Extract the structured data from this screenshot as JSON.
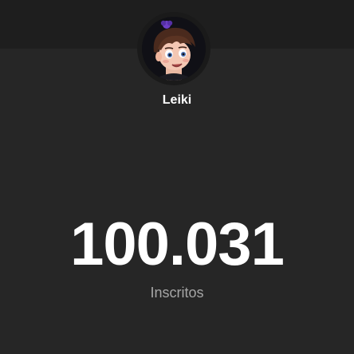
{
  "channel": {
    "name": "Leiki",
    "avatar_icon": "cartoon-avatar"
  },
  "subscribers": {
    "count": "100.031",
    "label": "Inscritos"
  }
}
